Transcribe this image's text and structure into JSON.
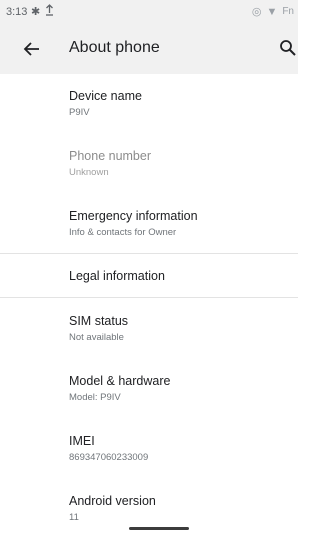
{
  "status_bar": {
    "time": "3:13",
    "right_text": "Fn"
  },
  "app_bar": {
    "title": "About phone"
  },
  "items": [
    {
      "title": "Device name",
      "subtitle": "P9IV"
    },
    {
      "title": "Phone number",
      "subtitle": "Unknown"
    },
    {
      "title": "Emergency information",
      "subtitle": "Info & contacts for Owner"
    },
    {
      "title": "Legal information"
    },
    {
      "title": "SIM status",
      "subtitle": "Not available"
    },
    {
      "title": "Model & hardware",
      "subtitle": "Model: P9IV"
    },
    {
      "title": "IMEI",
      "subtitle": "869347060233009"
    },
    {
      "title": "Android version",
      "subtitle": "11"
    }
  ]
}
